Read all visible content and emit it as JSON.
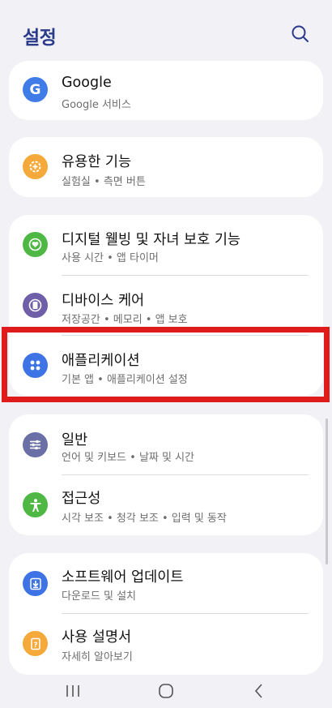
{
  "header": {
    "title": "설정",
    "search_icon": "search-icon"
  },
  "groups": [
    {
      "items": [
        {
          "icon": "google-icon",
          "icon_color": "#3f7ce8",
          "icon_glyph": "G",
          "label": "Google",
          "sub": "Google 서비스"
        }
      ]
    },
    {
      "items": [
        {
          "icon": "plus-gear-icon",
          "icon_color": "#f4a93a",
          "label": "유용한 기능",
          "sub": "실험실 • 측면 버튼"
        }
      ]
    },
    {
      "items": [
        {
          "icon": "wellbeing-heart-icon",
          "icon_color": "#4fb845",
          "label": "디지털 웰빙 및 자녀 보호 기능",
          "sub": "사용 시간 • 앱 타이머"
        },
        {
          "icon": "device-care-icon",
          "icon_color": "#6e5fa8",
          "label": "디바이스 케어",
          "sub": "저장공간 • 메모리 • 앱 보호"
        },
        {
          "icon": "apps-grid-icon",
          "icon_color": "#3e73e6",
          "label": "애플리케이션",
          "sub": "기본 앱 • 애플리케이션 설정"
        }
      ]
    },
    {
      "items": [
        {
          "icon": "sliders-icon",
          "icon_color": "#6a6fa6",
          "label": "일반",
          "sub": "언어 및 키보드 • 날짜 및 시간"
        },
        {
          "icon": "accessibility-icon",
          "icon_color": "#4fb845",
          "label": "접근성",
          "sub": "시각 보조 • 청각 보조 • 입력 및 동작"
        }
      ]
    },
    {
      "items": [
        {
          "icon": "software-update-icon",
          "icon_color": "#3e73e6",
          "label": "소프트웨어 업데이트",
          "sub": "다운로드 및 설치"
        },
        {
          "icon": "user-manual-icon",
          "icon_color": "#f4a93a",
          "label": "사용 설명서",
          "sub": "자세히 알아보기"
        }
      ]
    }
  ],
  "colors": {
    "highlight": "#e01b1b",
    "title": "#2b3a8a",
    "background": "#f1f1f6"
  },
  "navbar": {
    "recent": "recent-apps-icon",
    "home": "home-icon",
    "back": "back-icon"
  }
}
